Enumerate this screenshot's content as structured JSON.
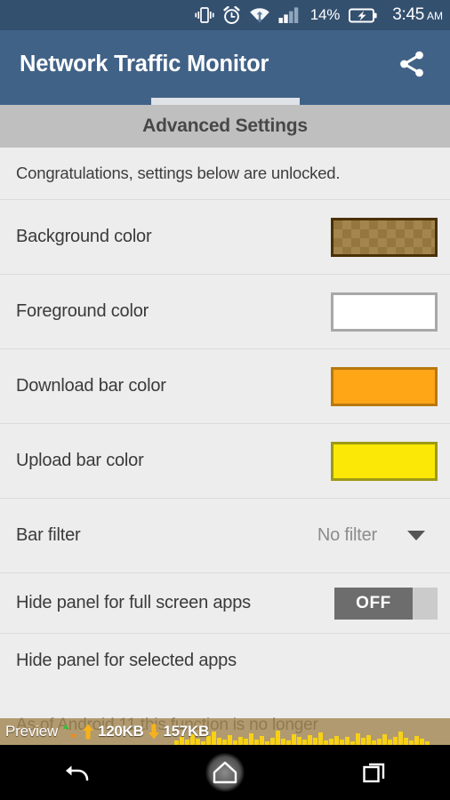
{
  "statusbar": {
    "icons": [
      "vibrate-icon",
      "alarm-icon",
      "wifi-icon",
      "signal-icon",
      "battery-charging-icon"
    ],
    "battery_percent": "14%",
    "time": "3:45",
    "ampm": "AM"
  },
  "appbar": {
    "title": "Network Traffic Monitor",
    "share_icon": "share-icon"
  },
  "section": {
    "title": "Advanced Settings"
  },
  "notice": {
    "text": "Congratulations, settings below are unlocked."
  },
  "settings": {
    "rows": [
      {
        "label": "Background color",
        "type": "color",
        "swatch": "#80560A",
        "transparent": true
      },
      {
        "label": "Foreground color",
        "type": "color",
        "swatch": "#FFFFFF",
        "transparent": false
      },
      {
        "label": "Download bar color",
        "type": "color",
        "swatch": "#FFA617",
        "transparent": false
      },
      {
        "label": "Upload bar color",
        "type": "color",
        "swatch": "#FBE807",
        "transparent": false
      },
      {
        "label": "Bar filter",
        "type": "dropdown",
        "value": "No filter",
        "caret": "chevron-down-icon"
      },
      {
        "label": "Hide panel for full screen apps",
        "type": "switch",
        "value": "OFF"
      },
      {
        "label": "Hide panel for selected apps",
        "type": "plain"
      }
    ]
  },
  "faded_text": "As of Android 11 this function is no longer",
  "preview": {
    "label": "Preview",
    "traffic_icon": "up-down-arrow-icon",
    "upload_icon": "arrow-up-icon",
    "upload_value": "120KB",
    "download_icon": "arrow-down-icon",
    "download_value": "157KB",
    "graph_bars": [
      5,
      9,
      6,
      12,
      7,
      4,
      10,
      15,
      8,
      6,
      11,
      5,
      9,
      7,
      13,
      6,
      10,
      4,
      8,
      16,
      7,
      5,
      12,
      9,
      6,
      11,
      8,
      14,
      5,
      7,
      10,
      6,
      9,
      4,
      13,
      8,
      11,
      5,
      7,
      12,
      6,
      9,
      15,
      8,
      5,
      10,
      7,
      4
    ],
    "bar_color": "#F7D117"
  },
  "navbar": {
    "back": "back-icon",
    "home": "home-icon",
    "recents": "recents-icon"
  },
  "colors": {
    "statusbar": "#34506F",
    "appbar": "#416287",
    "section_band": "#BFBFBF",
    "content": "#EDEDED"
  }
}
